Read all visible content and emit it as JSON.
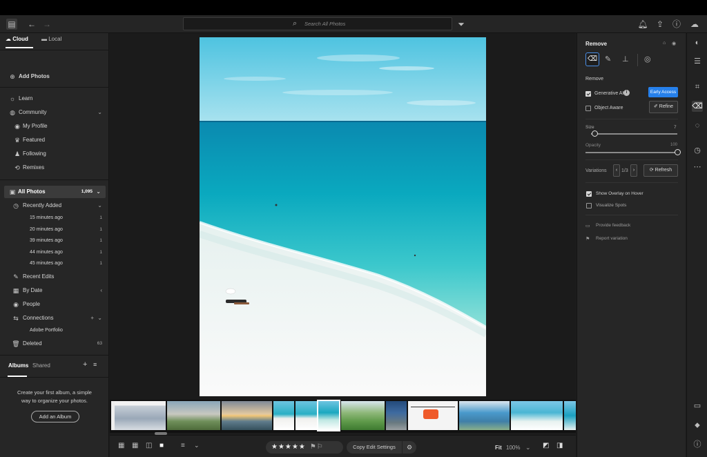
{
  "topbar": {
    "search_placeholder": "Search All Photos",
    "icons": [
      "sidebar-toggle-icon",
      "back-arrow-icon",
      "forward-arrow-icon",
      "filter-icon",
      "bell-icon",
      "share-icon",
      "help-icon",
      "cloud-icon"
    ]
  },
  "left_panel": {
    "tab_cloud": "Cloud",
    "tab_local": "Local",
    "add_photos": "Add Photos",
    "learn": "Learn",
    "community": "Community",
    "community_items": [
      "My Profile",
      "Featured",
      "Following",
      "Remixes"
    ],
    "all_photos": "All Photos",
    "all_photos_count": "1,095",
    "recently_added": "Recently Added",
    "recent_items": [
      {
        "label": "15 minutes ago",
        "count": "1"
      },
      {
        "label": "20 minutes ago",
        "count": "1"
      },
      {
        "label": "39 minutes ago",
        "count": "1"
      },
      {
        "label": "44 minutes ago",
        "count": "1"
      },
      {
        "label": "45 minutes ago",
        "count": "1"
      }
    ],
    "recent_edits": "Recent Edits",
    "by_date": "By Date",
    "people": "People",
    "connections": "Connections",
    "adobe_portfolio": "Adobe Portfolio",
    "deleted": "Deleted",
    "deleted_count": "63",
    "albums_tab": "Albums",
    "shared_tab": "Shared",
    "albums_message": "Create your first album, a simple way to organize your photos.",
    "add_album": "Add an Album"
  },
  "right_panel": {
    "title": "Remove",
    "section_label": "Remove",
    "generative_ai": "Generative AI",
    "generative_ai_checked": true,
    "early_access": "Early Access",
    "object_aware": "Object Aware",
    "object_aware_checked": false,
    "refine": "Refine",
    "size_label": "Size",
    "size_value": "7",
    "size_fraction": 0.04,
    "opacity_label": "Opacity",
    "opacity_value": "100",
    "opacity_fraction": 1.0,
    "variations_label": "Variations",
    "variations_value": "1/3",
    "refresh": "Refresh",
    "show_overlay": "Show Overlay on Hover",
    "show_overlay_checked": true,
    "visualize_spots": "Visualize Spots",
    "visualize_spots_checked": false,
    "provide_feedback": "Provide feedback",
    "report_variation": "Report variation"
  },
  "bottombar": {
    "rating_stars": "★★★★★",
    "copy_edit": "Copy Edit Settings",
    "fit": "Fit",
    "zoom": "100%"
  },
  "colors": {
    "accent_blue": "#2680eb",
    "panel_bg": "#262626"
  }
}
